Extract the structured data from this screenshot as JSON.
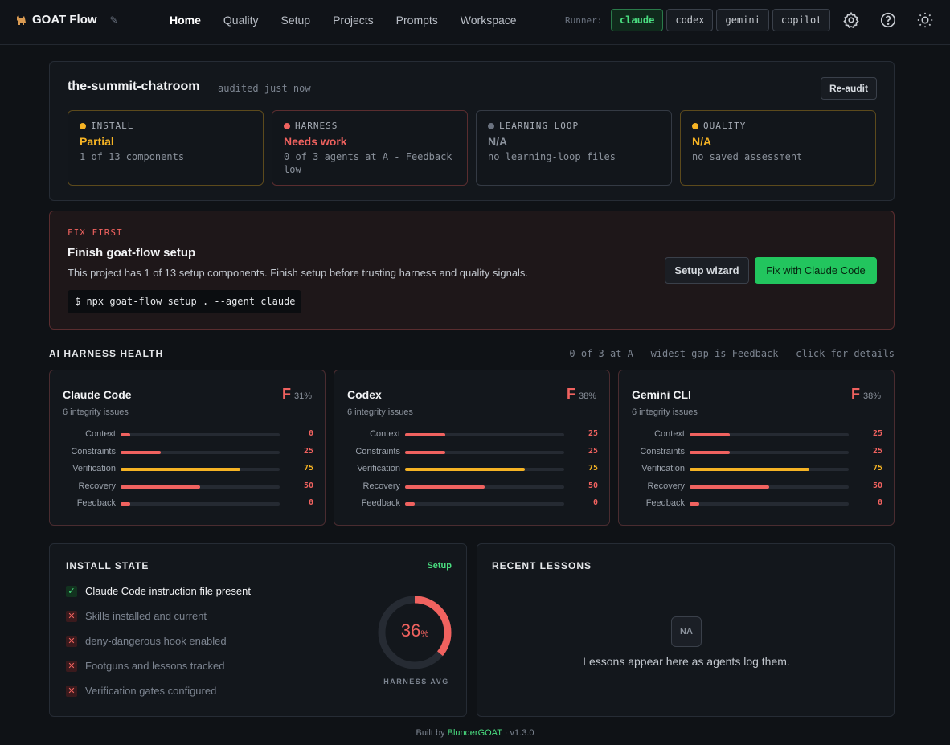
{
  "app": {
    "name": "GOAT Flow"
  },
  "nav": [
    "Home",
    "Quality",
    "Setup",
    "Projects",
    "Prompts",
    "Workspace"
  ],
  "runner": {
    "label": "Runner:",
    "options": [
      "claude",
      "codex",
      "gemini",
      "copilot"
    ],
    "selected": "claude"
  },
  "audit": {
    "project": "the-summit-chatroom",
    "status": "audited just now",
    "reaudit_label": "Re-audit",
    "stats": [
      {
        "label": "INSTALL",
        "value": "Partial",
        "desc": "1 of 13 components",
        "color": "#f5b324"
      },
      {
        "label": "HARNESS",
        "value": "Needs work",
        "desc": "0 of 3 agents at A - Feedback low",
        "color": "#f0625f"
      },
      {
        "label": "LEARNING LOOP",
        "value": "N/A",
        "desc": "no learning-loop files",
        "color": "#6b7380"
      },
      {
        "label": "QUALITY",
        "value": "N/A",
        "desc": "no saved assessment",
        "color": "#f5b324"
      }
    ]
  },
  "fix": {
    "tag": "FIX FIRST",
    "title": "Finish goat-flow setup",
    "desc": "This project has 1 of 13 setup components. Finish setup before trusting harness and quality signals.",
    "command": "$ npx goat-flow setup . --agent claude",
    "wizard_label": "Setup wizard",
    "claude_label": "Fix with Claude Code"
  },
  "harness": {
    "title": "AI HARNESS HEALTH",
    "note": "0 of 3 at A - widest gap is Feedback - click for details",
    "agents": [
      {
        "name": "Claude Code",
        "grade": "F",
        "percent": "31%",
        "issues": "6 integrity issues",
        "metrics": [
          {
            "label": "Context",
            "value": 0
          },
          {
            "label": "Constraints",
            "value": 25
          },
          {
            "label": "Verification",
            "value": 75
          },
          {
            "label": "Recovery",
            "value": 50
          },
          {
            "label": "Feedback",
            "value": 0
          }
        ]
      },
      {
        "name": "Codex",
        "grade": "F",
        "percent": "38%",
        "issues": "6 integrity issues",
        "metrics": [
          {
            "label": "Context",
            "value": 25
          },
          {
            "label": "Constraints",
            "value": 25
          },
          {
            "label": "Verification",
            "value": 75
          },
          {
            "label": "Recovery",
            "value": 50
          },
          {
            "label": "Feedback",
            "value": 0
          }
        ]
      },
      {
        "name": "Gemini CLI",
        "grade": "F",
        "percent": "38%",
        "issues": "6 integrity issues",
        "metrics": [
          {
            "label": "Context",
            "value": 25
          },
          {
            "label": "Constraints",
            "value": 25
          },
          {
            "label": "Verification",
            "value": 75
          },
          {
            "label": "Recovery",
            "value": 50
          },
          {
            "label": "Feedback",
            "value": 0
          }
        ]
      }
    ]
  },
  "install": {
    "title": "INSTALL STATE",
    "setup_link": "Setup",
    "items": [
      {
        "label": "Claude Code instruction file present",
        "ok": true
      },
      {
        "label": "Skills installed and current",
        "ok": false
      },
      {
        "label": "deny-dangerous hook enabled",
        "ok": false
      },
      {
        "label": "Footguns and lessons tracked",
        "ok": false
      },
      {
        "label": "Verification gates configured",
        "ok": false
      }
    ],
    "avg_value": "36",
    "avg_unit": "%",
    "avg_fraction": 0.36,
    "avg_label": "HARNESS AVG"
  },
  "lessons": {
    "title": "RECENT LESSONS",
    "badge": "NA",
    "empty_message": "Lessons appear here as agents log them."
  },
  "footer": {
    "prefix": "Built by",
    "author": "BlunderGOAT",
    "version": "· v1.3.0"
  },
  "colors": {
    "red": "#f0625f",
    "amber": "#f5b324",
    "green": "#22c55e"
  }
}
